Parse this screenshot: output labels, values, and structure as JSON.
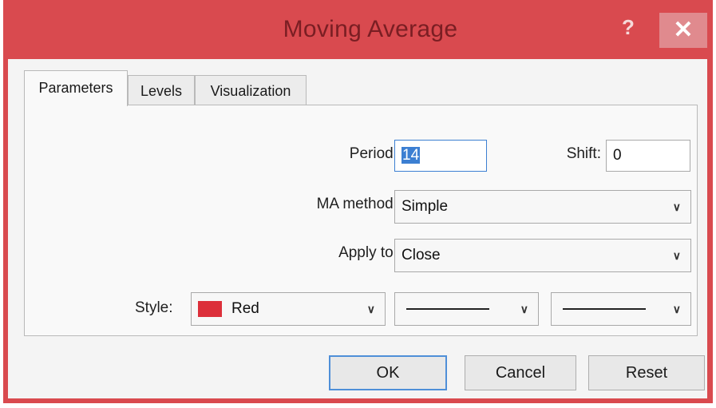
{
  "window": {
    "title": "Moving Average",
    "help_label": "?",
    "close_label": "✕"
  },
  "tabs": [
    {
      "label": "Parameters",
      "active": true
    },
    {
      "label": "Levels",
      "active": false
    },
    {
      "label": "Visualization",
      "active": false
    }
  ],
  "params": {
    "period_label": "Period:",
    "period_value": "14",
    "shift_label": "Shift:",
    "shift_value": "0",
    "ma_method_label": "MA method:",
    "ma_method_value": "Simple",
    "apply_to_label": "Apply to:",
    "apply_to_value": "Close",
    "style_label": "Style:",
    "style_color_name": "Red",
    "style_color_hex": "#dc2f3a"
  },
  "buttons": {
    "ok": "OK",
    "cancel": "Cancel",
    "reset": "Reset"
  },
  "icons": {
    "help": "help-icon",
    "close": "close-icon",
    "dropdown": "chevron-down-icon"
  },
  "colors": {
    "titlebar": "#d94a4f",
    "focus": "#3c7fd2"
  }
}
